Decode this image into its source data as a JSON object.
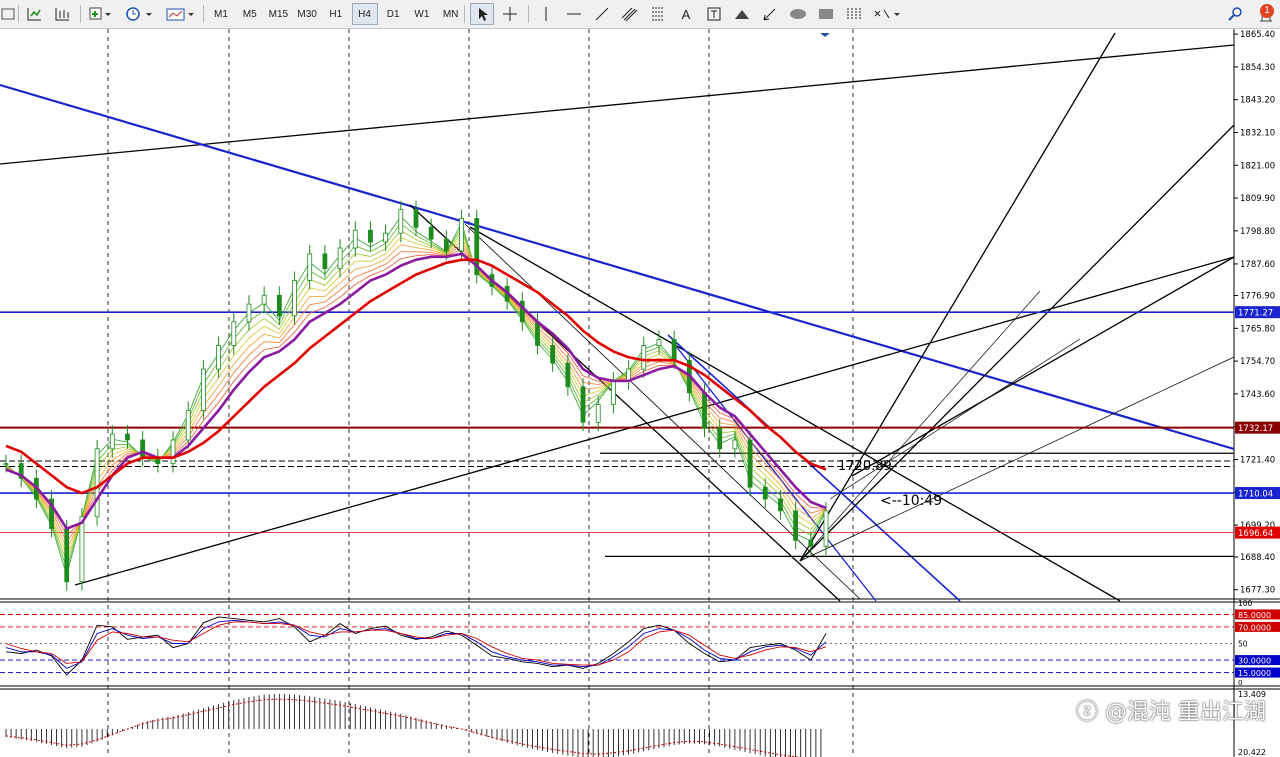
{
  "toolbar": {
    "timeframes": [
      "M1",
      "M5",
      "M15",
      "M30",
      "H1",
      "H4",
      "D1",
      "W1",
      "MN"
    ],
    "active_timeframe": "H4",
    "notification_count": "1",
    "icons": [
      "new-chart-icon",
      "profiles-icon",
      "add-indicator-icon",
      "clock-history-icon",
      "template-icon",
      "cursor-icon",
      "crosshair-icon",
      "vertical-line-icon",
      "horizontal-line-icon",
      "trend-line-icon",
      "equidistant-channel-icon",
      "fibonacci-icon",
      "text-icon",
      "text-label-icon",
      "arrow-up-icon",
      "arrow-down-icon",
      "ellipse-icon",
      "rectangle-icon",
      "fibonacci-fan-icon",
      "shapes-menu-icon",
      "search-icon",
      "notification-icon"
    ]
  },
  "colors": {
    "background": "#ffffff",
    "grid": "#000000",
    "blue_line": "#1a23d0",
    "maroon_line": "#8b0000",
    "red_ma": "#e00000",
    "purple_ma": "#8a1aa0",
    "candle": "#1f8a1f",
    "oscillator_red": "#d00000",
    "oscillator_blue": "#0000cc",
    "oscillator_black": "#000000"
  },
  "chart_data": [
    {
      "type": "line",
      "panel": "price",
      "yticks": [
        1865.4,
        1854.3,
        1843.2,
        1832.1,
        1821.0,
        1809.9,
        1798.8,
        1787.6,
        1776.9,
        1765.8,
        1754.7,
        1743.6,
        1732.5,
        1721.4,
        1710.3,
        1699.2,
        1688.4,
        1677.3
      ],
      "ylim": [
        1674.5,
        1866.8
      ],
      "price_labels": [
        {
          "text": "1771.27",
          "value": 1771.27,
          "color": "#1a23d0"
        },
        {
          "text": "1732.17",
          "value": 1732.17,
          "color": "#8b0000"
        },
        {
          "text": "1710.04",
          "value": 1710.04,
          "color": "#1a23d0"
        },
        {
          "text": "1696.64",
          "value": 1696.64,
          "color": "#e00000"
        }
      ],
      "annotations": [
        "1720.89",
        "<--10:49"
      ],
      "series": [
        {
          "values": [
            1720,
            1715,
            1708,
            1698,
            1680,
            1702,
            1725,
            1730,
            1728,
            1722,
            1720,
            1728,
            1738,
            1752,
            1760,
            1768,
            1774,
            1777,
            1770,
            1782,
            1791,
            1786,
            1793,
            1799,
            1795,
            1798,
            1806,
            1800,
            1796,
            1792,
            1803,
            1784,
            1780,
            1775,
            1768,
            1760,
            1754,
            1746,
            1734,
            1740,
            1748,
            1752,
            1760,
            1762,
            1755,
            1744,
            1732,
            1725,
            1728,
            1712,
            1708,
            1704,
            1694,
            1692,
            1704
          ]
        },
        {
          "values": [
            1718,
            1716,
            1712,
            1706,
            1698,
            1700,
            1708,
            1716,
            1722,
            1724,
            1722,
            1722,
            1726,
            1732,
            1738,
            1745,
            1751,
            1756,
            1758,
            1762,
            1768,
            1771,
            1774,
            1778,
            1782,
            1784,
            1787,
            1789,
            1790,
            1790,
            1791,
            1787,
            1782,
            1778,
            1773,
            1768,
            1764,
            1759,
            1752,
            1749,
            1748,
            1748,
            1750,
            1752,
            1753,
            1750,
            1744,
            1739,
            1736,
            1730,
            1724,
            1718,
            1712,
            1707,
            1705
          ]
        },
        {
          "values": [
            1726,
            1724,
            1720,
            1716,
            1712,
            1710,
            1712,
            1716,
            1720,
            1722,
            1722,
            1722,
            1724,
            1727,
            1731,
            1736,
            1741,
            1746,
            1750,
            1754,
            1759,
            1763,
            1767,
            1771,
            1775,
            1778,
            1781,
            1784,
            1786,
            1788,
            1789,
            1789,
            1787,
            1784,
            1781,
            1778,
            1774,
            1770,
            1765,
            1761,
            1758,
            1756,
            1755,
            1755,
            1755,
            1753,
            1750,
            1746,
            1742,
            1738,
            1733,
            1729,
            1724,
            1720,
            1718
          ]
        }
      ]
    },
    {
      "type": "line",
      "panel": "stochastic",
      "ylim": [
        0,
        100
      ],
      "levels_text": [
        "100",
        "85.0000",
        "70.0000",
        "50",
        "30.0000",
        "15.0000",
        "0"
      ],
      "levels": [
        85,
        70,
        50,
        30,
        15
      ],
      "series": [
        {
          "name": "",
          "values": [
            40,
            38,
            42,
            35,
            12,
            30,
            72,
            70,
            55,
            58,
            60,
            45,
            50,
            75,
            82,
            80,
            78,
            76,
            80,
            70,
            52,
            60,
            74,
            62,
            68,
            71,
            60,
            55,
            58,
            65,
            60,
            48,
            35,
            32,
            28,
            26,
            22,
            24,
            20,
            26,
            38,
            52,
            68,
            72,
            66,
            50,
            38,
            28,
            30,
            45,
            48,
            50,
            42,
            30,
            62
          ]
        },
        {
          "name": "",
          "values": [
            45,
            40,
            40,
            36,
            20,
            28,
            62,
            68,
            60,
            56,
            58,
            50,
            50,
            68,
            76,
            78,
            76,
            74,
            76,
            72,
            60,
            58,
            68,
            64,
            66,
            68,
            62,
            56,
            56,
            62,
            62,
            52,
            40,
            34,
            30,
            28,
            24,
            24,
            22,
            24,
            34,
            46,
            62,
            68,
            66,
            56,
            42,
            32,
            30,
            40,
            46,
            48,
            44,
            36,
            52
          ]
        },
        {
          "name": "",
          "values": [
            50,
            44,
            40,
            38,
            26,
            28,
            54,
            64,
            62,
            58,
            58,
            54,
            52,
            62,
            72,
            76,
            76,
            74,
            74,
            72,
            64,
            60,
            64,
            64,
            66,
            66,
            62,
            58,
            56,
            60,
            62,
            56,
            46,
            38,
            32,
            30,
            26,
            25,
            24,
            24,
            30,
            40,
            56,
            64,
            66,
            60,
            48,
            36,
            32,
            36,
            42,
            46,
            45,
            40,
            46
          ]
        }
      ]
    },
    {
      "type": "bar",
      "panel": "oscillator",
      "ytick_top": "13.409",
      "ytick_bottom": "20.422",
      "values": [
        -1,
        -1.3,
        -1.6,
        -2,
        -2.4,
        -2.2,
        -1.6,
        -0.8,
        0,
        0.8,
        1.3,
        1.6,
        2.1,
        2.6,
        3.1,
        3.6,
        4,
        4.3,
        4.4,
        4.3,
        4.1,
        3.8,
        3.5,
        3.1,
        2.7,
        2.3,
        1.9,
        1.4,
        0.9,
        0.4,
        0,
        -0.6,
        -1.2,
        -1.7,
        -2.2,
        -2.6,
        -3,
        -3.3,
        -3.6,
        -3.7,
        -3.5,
        -3.2,
        -2.8,
        -2.4,
        -2,
        -1.8,
        -1.9,
        -2.2,
        -2.6,
        -3,
        -3.4,
        -3.8,
        -4.1,
        -4.3,
        -4.2
      ]
    }
  ]
}
